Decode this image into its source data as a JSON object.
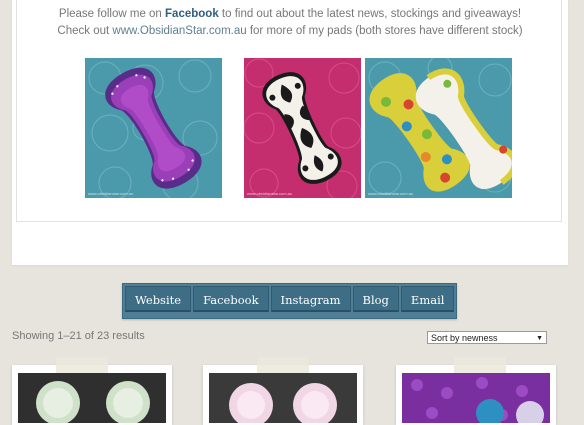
{
  "promo": {
    "line1_pre": "Please follow me on ",
    "line1_link": "Facebook",
    "line1_post": " to find out about the latest news, stockings and giveaways!",
    "line2_pre": "Check out ",
    "line2_link": "www.ObsidianStar.com.au",
    "line2_post": " for more of my pads (both stores have different stock)"
  },
  "gallery": {
    "watermarks": [
      "www.obsidianstar.com.au",
      "www.obsidianstar.com.au",
      "www.obsidianstar.com.au"
    ]
  },
  "nav": {
    "items": [
      "Website",
      "Facebook",
      "Instagram",
      "Blog",
      "Email"
    ]
  },
  "shop": {
    "results_text": "Showing 1–21 of 23 results",
    "sort_selected": "Sort by newness"
  },
  "colors": {
    "nav_bg": "#4e7f97",
    "nav_button": "#3e6e86",
    "link": "#2f5f7f",
    "page_bg": "#e7e3dd"
  }
}
